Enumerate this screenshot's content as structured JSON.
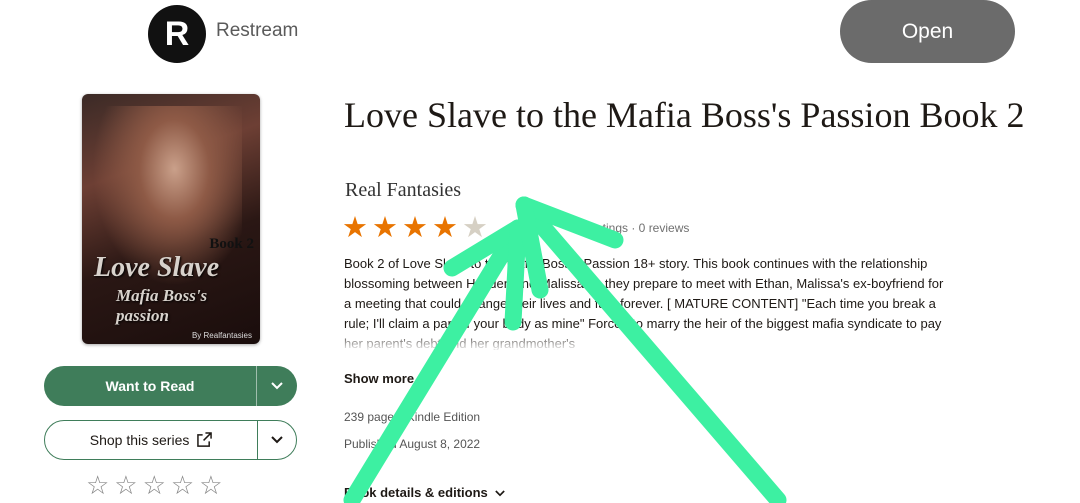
{
  "banner": {
    "logo_letter": "R",
    "app_name": "Restream",
    "open_label": "Open"
  },
  "cover": {
    "book_label": "Book 2",
    "title_line1": "Love Slave",
    "title_line2": "Mafia Boss's passion",
    "byline": "By Realfantasies"
  },
  "actions": {
    "want_to_read": "Want to Read",
    "shop_series": "Shop this series",
    "rate_stars": "☆☆☆☆☆"
  },
  "book": {
    "title": "Love Slave to the Mafia Boss's Passion Book 2",
    "author": "Real Fantasies",
    "rating_stars_filled": 4,
    "rating_stars_total": 5,
    "ratings_text": "ratings · 0 reviews",
    "description": "Book 2 of Love Slave to the Mafia Boss's Passion 18+ story. This book continues with the relationship blossoming between Hayden and Malissa as they prepare to meet with Ethan, Malissa's ex-boyfriend for a meeting that could change their lives and fate forever. [ MATURE CONTENT] \"Each time you break a rule; I'll claim a part of your body as mine\" Forced to marry the heir of the biggest mafia syndicate to pay her parent's debt and her grandmother's",
    "show_more": "Show more",
    "pages_format": "239 pages, Kindle Edition",
    "published": "Published August 8, 2022",
    "book_details": "Book details & editions"
  },
  "colors": {
    "accent_green": "#3f7d5a",
    "star_orange": "#e87400",
    "annotation_arrow": "#3df0a2"
  }
}
